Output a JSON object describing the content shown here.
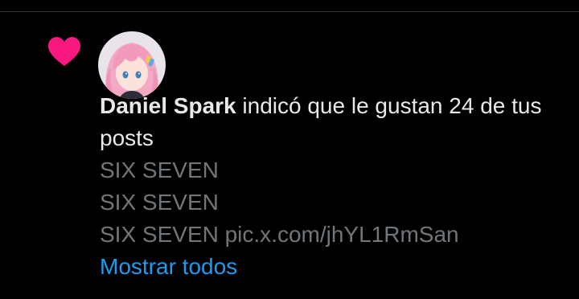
{
  "notification": {
    "user_name": "Daniel Spark",
    "action_text": " indicó que le gustan 24 de tus posts",
    "post_preview": [
      "SIX SEVEN",
      "SIX SEVEN",
      "SIX SEVEN pic.x.com/jhYL1RmSan"
    ],
    "show_all_label": "Mostrar todos",
    "icon": "heart-icon",
    "colors": {
      "heart": "#f91880",
      "link": "#1d9bf0",
      "text": "#e7e9ea",
      "muted": "#71767b",
      "background": "#000000"
    }
  }
}
